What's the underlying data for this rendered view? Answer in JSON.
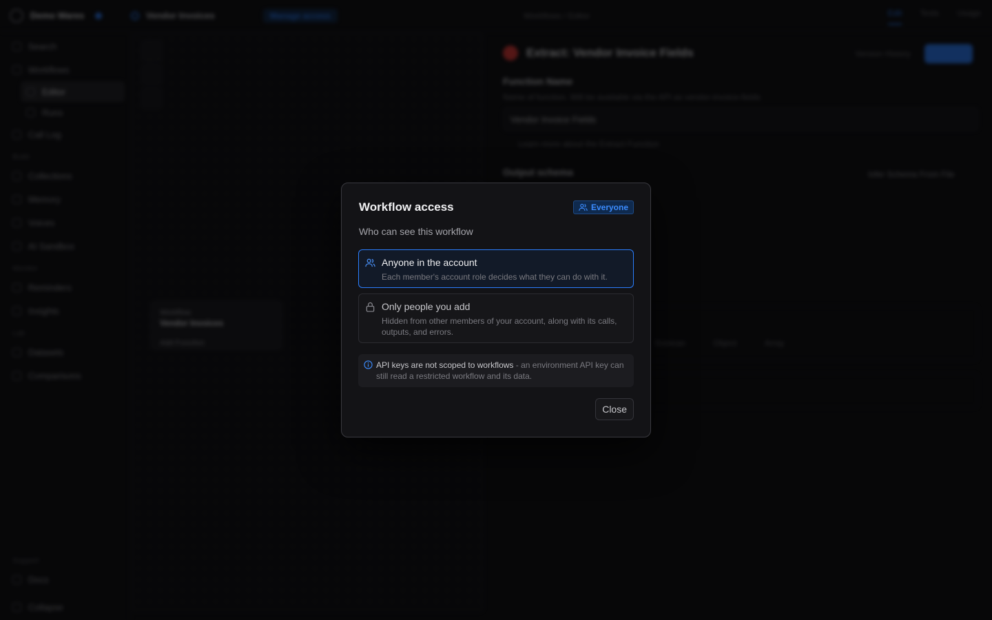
{
  "background": {
    "workspace_name": "Demo Wares",
    "breadcrumb": "Vendor Invoices",
    "manage_access": "Manage access",
    "center_crumb": "Workflows / Editor",
    "tabs": [
      "Edit",
      "Tests",
      "Usage"
    ],
    "sidebar": {
      "top_items": [
        "Search",
        "Workflows"
      ],
      "workflow_sub": [
        "Editor",
        "Runs"
      ],
      "more_items": [
        "Call Log"
      ],
      "build_label": "Build",
      "build_items": [
        "Collections",
        "Memory",
        "Voices",
        "AI Sandbox"
      ],
      "monitor_label": "Monitor",
      "monitor_items": [
        "Reminders",
        "Insights"
      ],
      "lab_label": "Lab",
      "lab_items": [
        "Datasets",
        "Comparisons"
      ],
      "support_label": "Support",
      "support_items": [
        "Docs",
        "Collapse"
      ]
    },
    "node": {
      "kind": "Workflow",
      "name": "Vendor Invoices",
      "footer": "Add Function"
    },
    "panel": {
      "title": "Extract: Vendor Invoice Fields",
      "version_history": "Version History",
      "function_name_label": "Function Name",
      "function_name_hint": "Name of function. Will be available via the API as vendor-invoice-fields",
      "function_name_value": "Vendor Invoice Fields",
      "learn_more": "Learn more about the Extract Function",
      "output_schema_label": "Output schema",
      "infer_schema": "Infer Schema From File",
      "type_options": [
        "Boolean",
        "Object",
        "Array"
      ]
    }
  },
  "dialog": {
    "title": "Workflow access",
    "badge": "Everyone",
    "subtitle": "Who can see this workflow",
    "options": [
      {
        "title": "Anyone in the account",
        "description": "Each member's account role decides what they can do with it.",
        "selected": true
      },
      {
        "title": "Only people you add",
        "description": "Hidden from other members of your account, along with its calls, outputs, and errors.",
        "selected": false
      }
    ],
    "note_bold": "API keys are not scoped to workflows",
    "note_rest": " - an environment API key can still read a restricted workflow and its data.",
    "close_label": "Close"
  },
  "colors": {
    "accent": "#2b7fff",
    "danger": "#e53935",
    "surface": "#131316"
  }
}
